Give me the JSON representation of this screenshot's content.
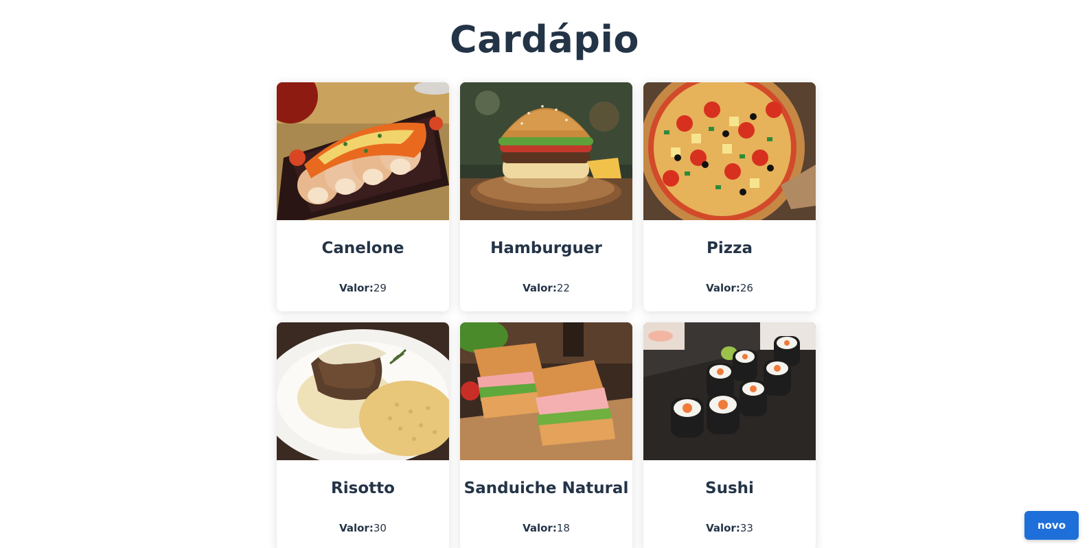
{
  "page": {
    "title": "Cardápio"
  },
  "price_label": "Valor:",
  "items": [
    {
      "name": "Canelone",
      "price": "29",
      "image": "canelone-photo"
    },
    {
      "name": "Hamburguer",
      "price": "22",
      "image": "hamburger-photo"
    },
    {
      "name": "Pizza",
      "price": "26",
      "image": "pizza-photo"
    },
    {
      "name": "Risotto",
      "price": "30",
      "image": "risotto-photo"
    },
    {
      "name": "Sanduiche Natural",
      "price": "18",
      "image": "sandwich-photo"
    },
    {
      "name": "Sushi",
      "price": "33",
      "image": "sushi-photo"
    }
  ],
  "actions": {
    "new_label": "novo"
  },
  "colors": {
    "title": "#243447",
    "button": "#1e6fd9",
    "background": "#ffffff"
  }
}
